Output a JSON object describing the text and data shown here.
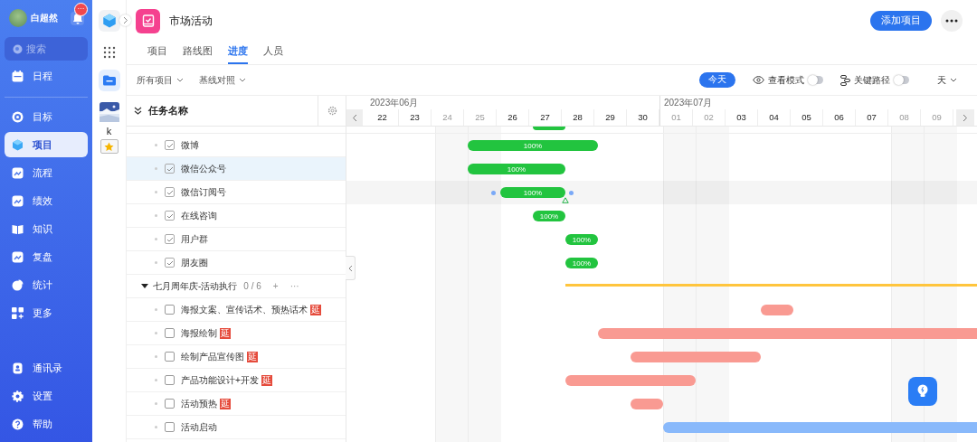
{
  "sidebar": {
    "user": {
      "name": "白超然",
      "badge": "···"
    },
    "search": {
      "placeholder": "搜索"
    },
    "top_items": [
      {
        "label": "日程",
        "selected": false
      }
    ],
    "main_items": [
      {
        "label": "目标",
        "selected": false
      },
      {
        "label": "项目",
        "selected": true
      },
      {
        "label": "流程",
        "selected": false
      },
      {
        "label": "绩效",
        "selected": false
      },
      {
        "label": "知识",
        "selected": false
      },
      {
        "label": "复盘",
        "selected": false
      },
      {
        "label": "统计",
        "selected": false
      },
      {
        "label": "更多",
        "selected": false
      }
    ],
    "bottom_items": [
      {
        "label": "通讯录",
        "selected": false
      },
      {
        "label": "设置",
        "selected": false
      },
      {
        "label": "帮助",
        "selected": false
      }
    ]
  },
  "app_rail": {
    "user_initial": "k"
  },
  "header": {
    "title": "市场活动",
    "add_button": "添加项目",
    "tabs": [
      {
        "label": "项目",
        "selected": false
      },
      {
        "label": "路线图",
        "selected": false
      },
      {
        "label": "进度",
        "selected": true
      },
      {
        "label": "人员",
        "selected": false
      }
    ]
  },
  "toolbar": {
    "filters": [
      "所有项目",
      "基线对照"
    ],
    "today_button": "今天",
    "toggles": [
      {
        "label": "查看模式",
        "on": false
      },
      {
        "label": "关键路径",
        "on": false
      }
    ],
    "scale": "天"
  },
  "gantt": {
    "column_title": "任务名称",
    "months": [
      {
        "label": "2023年06月",
        "days": [
          {
            "label": "22",
            "weekend": false
          },
          {
            "label": "23",
            "weekend": false
          },
          {
            "label": "24",
            "weekend": true
          },
          {
            "label": "25",
            "weekend": true
          },
          {
            "label": "26",
            "weekend": false
          },
          {
            "label": "27",
            "weekend": false
          },
          {
            "label": "28",
            "weekend": false
          },
          {
            "label": "29",
            "weekend": false
          },
          {
            "label": "30",
            "weekend": false
          }
        ]
      },
      {
        "label": "2023年07月",
        "days": [
          {
            "label": "01",
            "weekend": true
          },
          {
            "label": "02",
            "weekend": true
          },
          {
            "label": "03",
            "weekend": false
          },
          {
            "label": "04",
            "weekend": false
          },
          {
            "label": "05",
            "weekend": false
          },
          {
            "label": "06",
            "weekend": false
          },
          {
            "label": "07",
            "weekend": false
          },
          {
            "label": "08",
            "weekend": true
          },
          {
            "label": "09",
            "weekend": true
          }
        ]
      }
    ],
    "rows": [
      {
        "kind": "task",
        "name": "微博",
        "checked": true,
        "selected": false,
        "hovered": false,
        "bar": {
          "kind": "done",
          "label": "100%",
          "cells": [
            false,
            false,
            false,
            true,
            true,
            true,
            true,
            false,
            false,
            false,
            false,
            false,
            false,
            false,
            false,
            false,
            false,
            false
          ]
        }
      },
      {
        "kind": "task",
        "name": "微信公众号",
        "checked": true,
        "selected": true,
        "hovered": false,
        "bar": {
          "kind": "done",
          "label": "100%",
          "cells": [
            false,
            false,
            false,
            true,
            true,
            true,
            false,
            false,
            false,
            false,
            false,
            false,
            false,
            false,
            false,
            false,
            false,
            false
          ]
        }
      },
      {
        "kind": "task",
        "name": "微信订阅号",
        "checked": true,
        "selected": false,
        "hovered": true,
        "bar": {
          "kind": "done",
          "label": "100%",
          "cells": [
            false,
            false,
            false,
            false,
            true,
            true,
            false,
            false,
            false,
            false,
            false,
            false,
            false,
            false,
            false,
            false,
            false,
            false
          ]
        }
      },
      {
        "kind": "task",
        "name": "在线咨询",
        "checked": true,
        "selected": false,
        "hovered": false,
        "bar": {
          "kind": "done",
          "label": "100%",
          "cells": [
            false,
            false,
            false,
            false,
            false,
            true,
            false,
            false,
            false,
            false,
            false,
            false,
            false,
            false,
            false,
            false,
            false,
            false
          ]
        }
      },
      {
        "kind": "task",
        "name": "用户群",
        "checked": true,
        "selected": false,
        "hovered": false,
        "bar": {
          "kind": "done",
          "label": "100%",
          "cells": [
            false,
            false,
            false,
            false,
            false,
            false,
            true,
            false,
            false,
            false,
            false,
            false,
            false,
            false,
            false,
            false,
            false,
            false
          ]
        }
      },
      {
        "kind": "task",
        "name": "朋友圈",
        "checked": true,
        "selected": false,
        "hovered": false,
        "bar": {
          "kind": "done",
          "label": "100%",
          "cells": [
            false,
            false,
            false,
            false,
            false,
            false,
            true,
            false,
            false,
            false,
            false,
            false,
            false,
            false,
            false,
            false,
            false,
            false
          ]
        }
      },
      {
        "kind": "group",
        "name": "七月周年庆-活动执行",
        "count": "0 / 6",
        "add": "+",
        "more": "···",
        "expanded": true,
        "bar": {
          "kind": "summary",
          "cells": [
            false,
            false,
            false,
            false,
            false,
            false,
            true,
            true,
            true,
            true,
            true,
            true,
            true,
            true,
            true,
            true,
            true,
            true
          ]
        }
      },
      {
        "kind": "task",
        "name": "海报文案、宣传话术、预热话术",
        "checked": false,
        "selected": false,
        "hovered": false,
        "badge": "延",
        "bar": {
          "kind": "delayed",
          "cells": [
            false,
            false,
            false,
            false,
            false,
            false,
            false,
            false,
            false,
            false,
            false,
            false,
            true,
            false,
            false,
            false,
            false,
            false
          ]
        }
      },
      {
        "kind": "task",
        "name": "海报绘制",
        "checked": false,
        "selected": false,
        "hovered": false,
        "badge": "延",
        "bar": {
          "kind": "delayed",
          "cells": [
            false,
            false,
            false,
            false,
            false,
            false,
            false,
            true,
            true,
            true,
            true,
            true,
            true,
            true,
            true,
            true,
            true,
            true
          ]
        }
      },
      {
        "kind": "task",
        "name": "绘制产品宣传图",
        "checked": false,
        "selected": false,
        "hovered": false,
        "badge": "延",
        "bar": {
          "kind": "delayed",
          "cells": [
            false,
            false,
            false,
            false,
            false,
            false,
            false,
            false,
            true,
            true,
            true,
            true,
            false,
            false,
            false,
            false,
            false,
            false
          ]
        }
      },
      {
        "kind": "task",
        "name": "产品功能设计+开发",
        "checked": false,
        "selected": false,
        "hovered": false,
        "badge": "延",
        "bar": {
          "kind": "delayed",
          "cells": [
            false,
            false,
            false,
            false,
            false,
            false,
            true,
            true,
            true,
            true,
            false,
            false,
            false,
            false,
            false,
            false,
            false,
            false
          ]
        }
      },
      {
        "kind": "task",
        "name": "活动预热",
        "checked": false,
        "selected": false,
        "hovered": false,
        "badge": "延",
        "bar": {
          "kind": "delayed",
          "cells": [
            false,
            false,
            false,
            false,
            false,
            false,
            false,
            false,
            true,
            false,
            false,
            false,
            false,
            false,
            false,
            false,
            false,
            false
          ]
        }
      },
      {
        "kind": "task",
        "name": "活动启动",
        "checked": false,
        "selected": false,
        "hovered": false,
        "bar": {
          "kind": "planned",
          "cells": [
            false,
            false,
            false,
            false,
            false,
            false,
            false,
            false,
            false,
            true,
            true,
            true,
            true,
            true,
            true,
            true,
            true,
            true
          ]
        }
      }
    ]
  }
}
